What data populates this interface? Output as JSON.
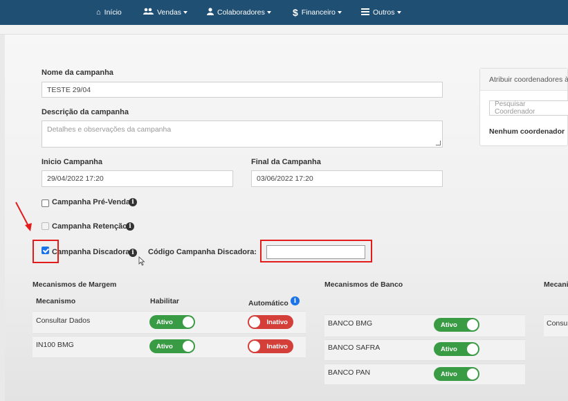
{
  "nav": {
    "items": [
      {
        "label": "Início",
        "icon": "home-icon",
        "caret": false
      },
      {
        "label": "Vendas",
        "icon": "users-icon",
        "caret": true
      },
      {
        "label": "Colaboradores",
        "icon": "user-icon",
        "caret": true
      },
      {
        "label": "Financeiro",
        "icon": "dollar-icon",
        "caret": true
      },
      {
        "label": "Outros",
        "icon": "list-icon",
        "caret": true
      }
    ]
  },
  "form": {
    "nome_label": "Nome da campanha",
    "nome_value": "TESTE 29/04",
    "descricao_label": "Descrição da campanha",
    "descricao_placeholder": "Detalhes e observações da campanha",
    "inicio_label": "Inicio Campanha",
    "inicio_value": "29/04/2022 17:20",
    "final_label": "Final da Campanha",
    "final_value": "03/06/2022 17:20",
    "pre_venda_label": "Campanha Pré-Venda",
    "pre_venda_checked": false,
    "retencao_label": "Campanha Retenção",
    "retencao_checked": false,
    "discadora_label": "Campanha Discadora",
    "discadora_checked": true,
    "codigo_discadora_label": "Código Campanha Discadora:",
    "codigo_discadora_value": ""
  },
  "sidecard": {
    "title": "Atribuir coordenadores à",
    "search_placeholder": "Pesquisar Coordenador",
    "empty_text": "Nenhum coordenador"
  },
  "margem": {
    "title": "Mecanismos de Margem",
    "headers": {
      "mecanismo": "Mecanismo",
      "habilitar": "Habilitar",
      "automatico": "Automático"
    },
    "rows": [
      {
        "name": "Consultar Dados",
        "habilitar": "Ativo",
        "automatico": "Inativo"
      },
      {
        "name": "IN100 BMG",
        "habilitar": "Ativo",
        "automatico": "Inativo"
      }
    ]
  },
  "banco": {
    "title": "Mecanismos de Banco",
    "rows": [
      {
        "name": "BANCO BMG",
        "status": "Ativo"
      },
      {
        "name": "BANCO SAFRA",
        "status": "Ativo"
      },
      {
        "name": "BANCO PAN",
        "status": "Ativo"
      }
    ]
  },
  "third": {
    "title": "Mecani",
    "row_text": "Consu"
  },
  "colors": {
    "topbar": "#1f4f73",
    "active": "#3a9b45",
    "inactive": "#d43f3a",
    "highlight": "#e31b1b"
  }
}
